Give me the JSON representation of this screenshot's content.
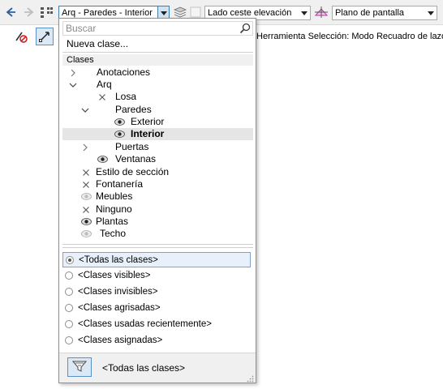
{
  "toolbar": {
    "class_combo_value": "Arq - Paredes - Interior",
    "side_combo_value": "Lado ceste elevación",
    "plane_combo_value": "Plano de pantalla"
  },
  "mode_bar": {
    "hint": "Herramienta Selección: Modo Recuadro de lazo"
  },
  "class_panel": {
    "search_placeholder": "Buscar",
    "new_class": "Nueva clase...",
    "section_header": "Clases",
    "tree": [
      {
        "label": "Anotaciones",
        "toggle": "collapsed",
        "state": "none"
      },
      {
        "label": "Arq",
        "toggle": "expanded",
        "state": "none"
      },
      {
        "label": "Losa",
        "toggle": "none",
        "state": "invisible"
      },
      {
        "label": "Paredes",
        "toggle": "expanded",
        "state": "none"
      },
      {
        "label": "Exterior",
        "toggle": "none",
        "state": "visible"
      },
      {
        "label": "Interior",
        "toggle": "none",
        "state": "visible",
        "selected": true
      },
      {
        "label": "Puertas",
        "toggle": "collapsed",
        "state": "none"
      },
      {
        "label": "Ventanas",
        "toggle": "none",
        "state": "visible"
      },
      {
        "label": "Estilo de sección",
        "toggle": "none",
        "state": "invisible"
      },
      {
        "label": "Fontanería",
        "toggle": "none",
        "state": "invisible"
      },
      {
        "label": "Meubles",
        "toggle": "none",
        "state": "grayed"
      },
      {
        "label": "Ninguno",
        "toggle": "none",
        "state": "invisible"
      },
      {
        "label": "Plantas",
        "toggle": "none",
        "state": "visible"
      },
      {
        "label": "Techo",
        "toggle": "none",
        "state": "grayed"
      }
    ],
    "filters": [
      {
        "label": "<Todas las clases>",
        "selected": true
      },
      {
        "label": "<Clases visibles>",
        "selected": false
      },
      {
        "label": "<Clases invisibles>",
        "selected": false
      },
      {
        "label": "<Clases agrisadas>",
        "selected": false
      },
      {
        "label": "<Clases usadas recientemente>",
        "selected": false
      },
      {
        "label": "<Clases asignadas>",
        "selected": false
      }
    ],
    "footer_label": "<Todas las clases>"
  },
  "colors": {
    "accent": "#3c7fb1",
    "selection": "#e5e5e5"
  }
}
